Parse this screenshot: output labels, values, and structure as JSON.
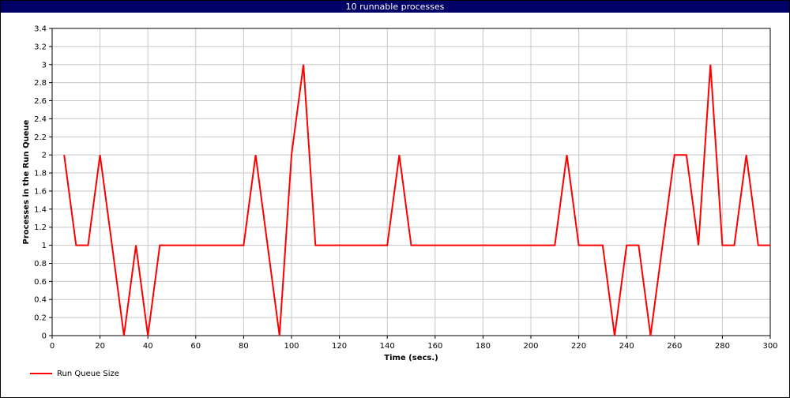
{
  "window": {
    "title": "10 runnable processes"
  },
  "colors": {
    "series": "#ff0000",
    "title_bar": "#000066",
    "grid": "#c8c8c8"
  },
  "chart_data": {
    "type": "line",
    "title": "10 runnable processes",
    "xlabel": "Time (secs.)",
    "ylabel": "Processes in the Run Queue",
    "xlim": [
      0,
      300
    ],
    "ylim": [
      0,
      3.4
    ],
    "xticks": [
      0,
      20,
      40,
      60,
      80,
      100,
      120,
      140,
      160,
      180,
      200,
      220,
      240,
      260,
      280,
      300
    ],
    "yticks": [
      0,
      0.2,
      0.4,
      0.6,
      0.8,
      1,
      1.2,
      1.4,
      1.6,
      1.8,
      2,
      2.2,
      2.4,
      2.6,
      2.8,
      3,
      3.2,
      3.4
    ],
    "grid": true,
    "legend_position": "bottom-left",
    "series": [
      {
        "name": "Run Queue Size",
        "x": [
          5,
          10,
          15,
          20,
          25,
          30,
          35,
          40,
          45,
          50,
          55,
          60,
          65,
          70,
          75,
          80,
          85,
          90,
          95,
          100,
          105,
          110,
          115,
          120,
          125,
          130,
          135,
          140,
          145,
          150,
          155,
          160,
          165,
          170,
          175,
          180,
          185,
          190,
          195,
          200,
          205,
          210,
          215,
          220,
          225,
          230,
          235,
          240,
          245,
          250,
          255,
          260,
          265,
          270,
          275,
          280,
          285,
          290,
          295,
          300
        ],
        "y": [
          2,
          1,
          1,
          2,
          1,
          0,
          1,
          0,
          1,
          1,
          1,
          1,
          1,
          1,
          1,
          1,
          2,
          1,
          0,
          2,
          3,
          1,
          1,
          1,
          1,
          1,
          1,
          1,
          2,
          1,
          1,
          1,
          1,
          1,
          1,
          1,
          1,
          1,
          1,
          1,
          1,
          1,
          2,
          1,
          1,
          1,
          0,
          1,
          1,
          0,
          1,
          2,
          2,
          1,
          3,
          1,
          1,
          2,
          1,
          1
        ]
      }
    ]
  }
}
